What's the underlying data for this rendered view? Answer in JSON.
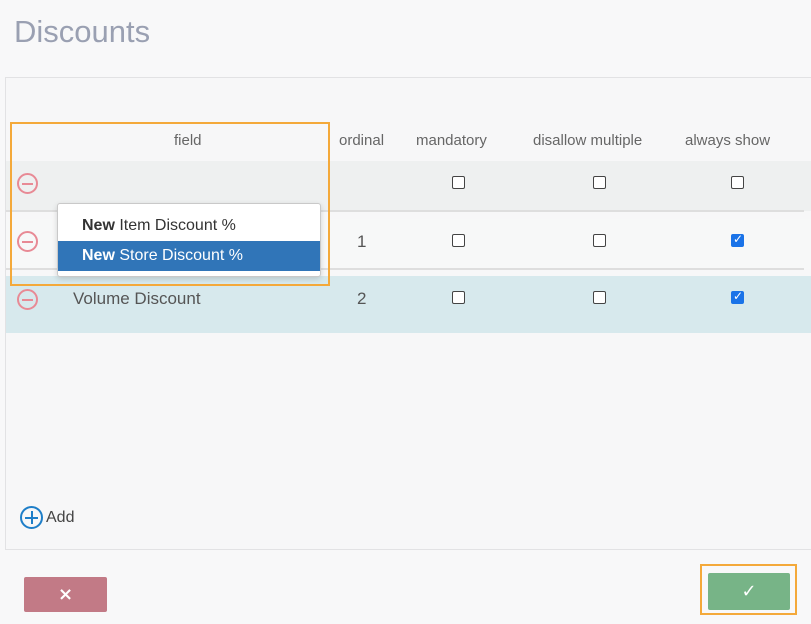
{
  "title": "Discounts",
  "columns": {
    "field": "field",
    "ordinal": "ordinal",
    "mandatory": "mandatory",
    "disallow_multiple": "disallow multiple",
    "always_show": "always show"
  },
  "rows": [
    {
      "field": "",
      "ordinal": "",
      "mandatory": false,
      "disallow_multiple": false,
      "always_show": false
    },
    {
      "field": "",
      "ordinal": "1",
      "mandatory": false,
      "disallow_multiple": false,
      "always_show": true
    },
    {
      "field": "Volume Discount",
      "ordinal": "2",
      "mandatory": false,
      "disallow_multiple": false,
      "always_show": true
    }
  ],
  "dropdown": {
    "options": [
      {
        "prefix": "New",
        "label": "Item Discount %",
        "selected": false
      },
      {
        "prefix": "New",
        "label": "Store Discount %",
        "selected": true
      }
    ]
  },
  "add_label": "Add",
  "buttons": {
    "cancel_icon": "×",
    "confirm_icon": "✓"
  },
  "colors": {
    "highlight": "#f4a93a",
    "selected_option": "#3075b8",
    "cancel": "#c27a86",
    "confirm": "#77b487",
    "checkbox_checked": "#1a73e8"
  }
}
